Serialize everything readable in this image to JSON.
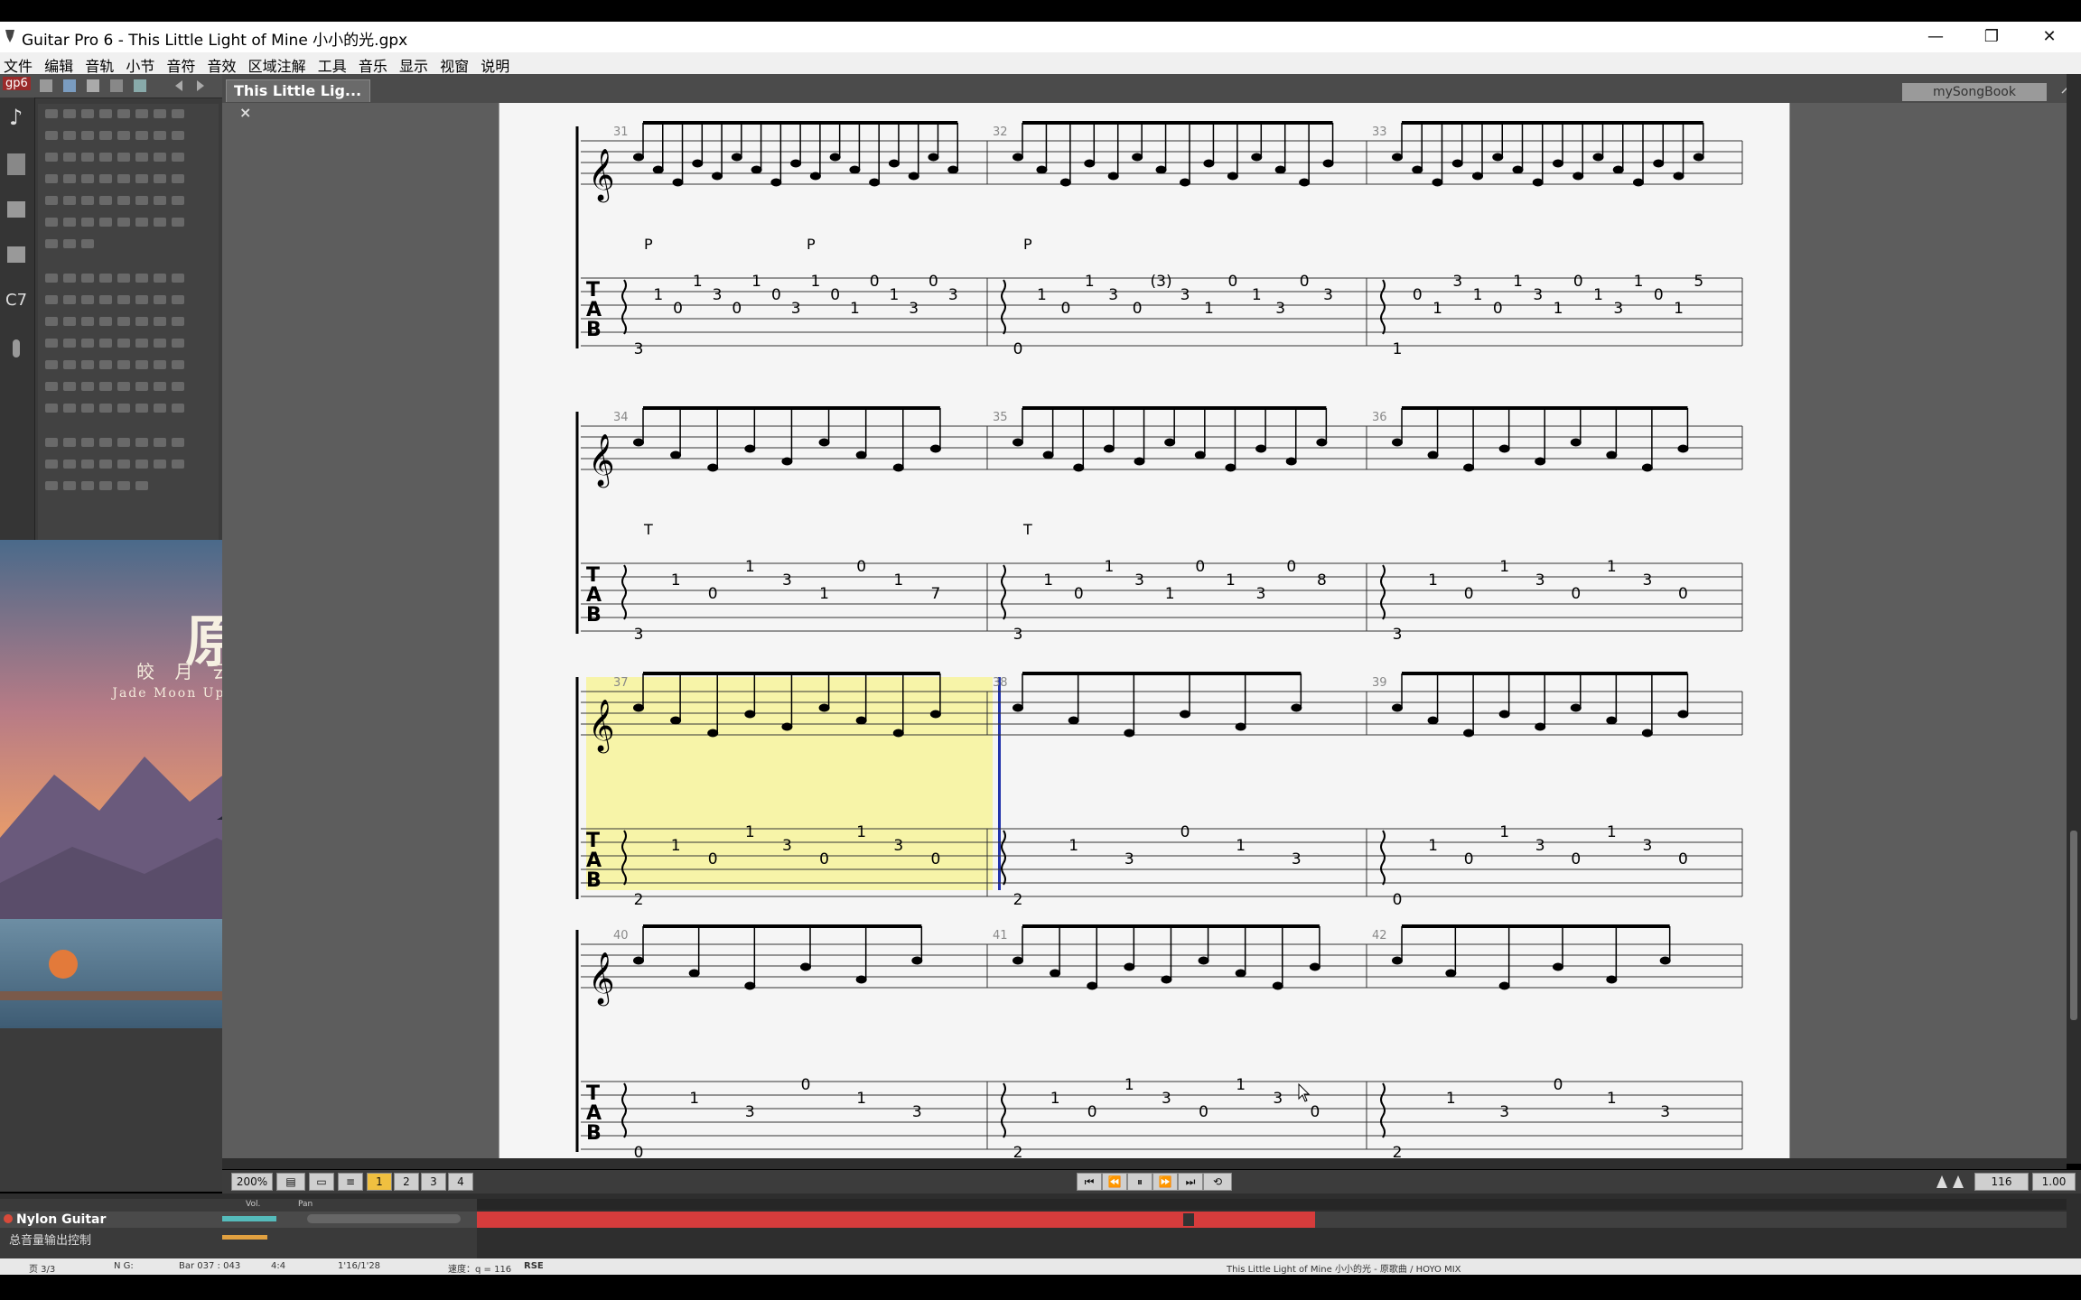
{
  "window": {
    "title": "Guitar Pro 6 - This Little Light of Mine 小小的光.gpx",
    "minimize": "—",
    "maximize": "❐",
    "close": "✕"
  },
  "menu": [
    "文件",
    "编辑",
    "音轨",
    "小节",
    "音符",
    "音效",
    "区域注解",
    "工具",
    "音乐",
    "显示",
    "视窗",
    "说明"
  ],
  "toolbar": {
    "logo": "gp6"
  },
  "tab": {
    "label": "This Little Lig...",
    "close": "×"
  },
  "songbook": {
    "label": "mySongBook"
  },
  "album": {
    "title": "原神",
    "subtitle": "皎 月 云 间 之 梦",
    "subtitle_en": "Jade Moon Upon a Sea of Clouds"
  },
  "score": {
    "systems": [
      {
        "bars": [
          {
            "number": "31",
            "tab": "3-1-0-1-3-0-1-0-3-1-0-1-0-1-3-0-3",
            "markers": [
              "P",
              "P"
            ]
          },
          {
            "number": "32",
            "tab": "0-1-0-1-3-0-(3)-3-1-0-1-3-0-3",
            "markers": [
              "P"
            ]
          },
          {
            "number": "33",
            "tab": "1-0-1-3-1-0-1-3-1-0-1-3-1-0-1-5",
            "markers": []
          }
        ]
      },
      {
        "bars": [
          {
            "number": "34",
            "tab": "3-1-0-1-3-1-0-1-7",
            "markers": [
              "T"
            ]
          },
          {
            "number": "35",
            "tab": "3-1-0-1-3-1-0-1-3-0-8",
            "markers": [
              "T"
            ]
          },
          {
            "number": "36",
            "tab": "3-1-0-1-3-0-1-3-0",
            "markers": []
          }
        ]
      },
      {
        "bars": [
          {
            "number": "37",
            "tab": "2-1-0-1-3-0-1-3-0",
            "markers": []
          },
          {
            "number": "38",
            "tab": "2-1-3-0-1-3",
            "markers": []
          },
          {
            "number": "39",
            "tab": "0-1-0-1-3-0-1-3-0",
            "markers": []
          }
        ]
      },
      {
        "bars": [
          {
            "number": "40",
            "tab": "0-1-3-0-1-3",
            "markers": []
          },
          {
            "number": "41",
            "tab": "2-1-0-1-3-0-1-3-0",
            "markers": []
          },
          {
            "number": "42",
            "tab": "2-1-3-0-1-3",
            "markers": []
          }
        ]
      }
    ]
  },
  "transport": {
    "zoom": "200%",
    "tempo": "116",
    "speed": "1.00"
  },
  "tracks": [
    {
      "name": "Nylon Guitar"
    },
    {
      "name": "总音量输出控制"
    }
  ],
  "track_header": {
    "vol": "Vol.",
    "pan": "Pan"
  },
  "status": {
    "page": "页 3/3",
    "key": "N G:",
    "bar": "Bar 037 : 043",
    "sig": "4:4",
    "time": "1'16/1'28",
    "tempo": "速度：q = 116",
    "rse": "RSE",
    "song": "This Little Light of Mine 小小的光 - 原歌曲 / HOYO MIX"
  }
}
